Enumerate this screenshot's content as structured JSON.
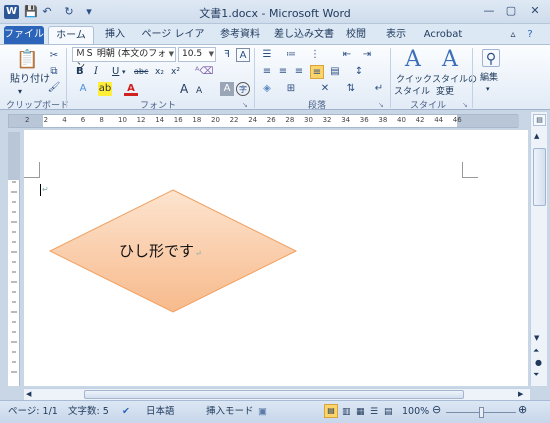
{
  "window": {
    "title": "文書1.docx - Microsoft Word",
    "app_icon_letter": "W"
  },
  "quick_access": [
    {
      "name": "save-icon",
      "glyph": "💾"
    },
    {
      "name": "undo-icon",
      "glyph": "↶"
    },
    {
      "name": "redo-icon",
      "glyph": "↻"
    },
    {
      "name": "customize-qat-icon",
      "glyph": "▾"
    }
  ],
  "window_controls": [
    {
      "name": "minimize-icon",
      "glyph": "—"
    },
    {
      "name": "maximize-icon",
      "glyph": "▢"
    },
    {
      "name": "close-icon",
      "glyph": "✕"
    }
  ],
  "tabs": [
    "ファイル",
    "ホーム",
    "挿入",
    "ページ レイアウト",
    "参考資料",
    "差し込み文書",
    "校閲",
    "表示",
    "Acrobat"
  ],
  "ribbon": {
    "clipboard": {
      "paste_label": "貼り付け",
      "group_label": "クリップボード"
    },
    "font": {
      "font_name": "ＭＳ 明朝 (本文のフォン",
      "font_size": "10.5",
      "bold": "B",
      "italic": "I",
      "underline": "U",
      "strike": "abc",
      "subscript": "x₂",
      "superscript": "x²",
      "grow": "A",
      "shrink": "A",
      "group_label": "フォント"
    },
    "paragraph": {
      "group_label": "段落"
    },
    "styles": {
      "quick_style_line1": "クイック",
      "quick_style_line2": "スタイル",
      "change_style_line1": "スタイルの",
      "change_style_line2": "変更",
      "group_label": "スタイル"
    },
    "editing": {
      "label": "編集"
    }
  },
  "ruler_numbers": [
    "2",
    "2",
    "4",
    "6",
    "8",
    "10",
    "12",
    "14",
    "16",
    "18",
    "20",
    "22",
    "24",
    "26",
    "28",
    "30",
    "32",
    "34",
    "36",
    "38",
    "40",
    "42",
    "44",
    "46"
  ],
  "document": {
    "shape_text": "ひし形です",
    "shape_fill_top": "#fde4cf",
    "shape_fill_bottom": "#f7ba8c",
    "shape_stroke": "#f0a060"
  },
  "status": {
    "page": "ページ: 1/1",
    "words": "文字数: 5",
    "language": "日本語",
    "mode": "挿入モード",
    "zoom": "100%"
  },
  "colors": {
    "file_tab": "#2b64b9",
    "ribbon_bg": "#e2ebf6"
  }
}
